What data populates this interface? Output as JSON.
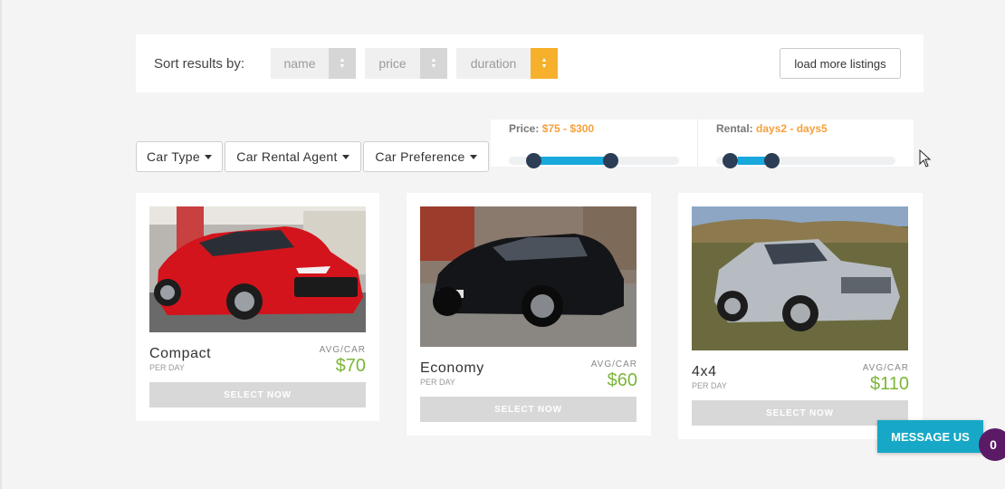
{
  "sort": {
    "label": "Sort results by:",
    "options": [
      {
        "label": "name",
        "active": false
      },
      {
        "label": "price",
        "active": false
      },
      {
        "label": "duration",
        "active": true
      }
    ],
    "load_more": "load more listings"
  },
  "filters": {
    "car_type": "Car Type",
    "agent": "Car Rental Agent",
    "preference": "Car Preference"
  },
  "price_range": {
    "label": "Price:",
    "value": "$75 - $300"
  },
  "rental_range": {
    "label": "Rental:",
    "value": "days2 - days5"
  },
  "cars": [
    {
      "name": "Compact",
      "per": "PER DAY",
      "avg": "AVG/CAR",
      "price": "$70",
      "cta": "SELECT NOW"
    },
    {
      "name": "Economy",
      "per": "PER DAY",
      "avg": "AVG/CAR",
      "price": "$60",
      "cta": "SELECT NOW"
    },
    {
      "name": "4x4",
      "per": "PER DAY",
      "avg": "AVG/CAR",
      "price": "$110",
      "cta": "SELECT NOW"
    }
  ],
  "chat": {
    "label": "MESSAGE US",
    "count": "0"
  },
  "colors": {
    "accent": "#f6b02b",
    "slider": "#18a8dc",
    "price": "#7cb63a",
    "chat": "#16a8c6"
  }
}
